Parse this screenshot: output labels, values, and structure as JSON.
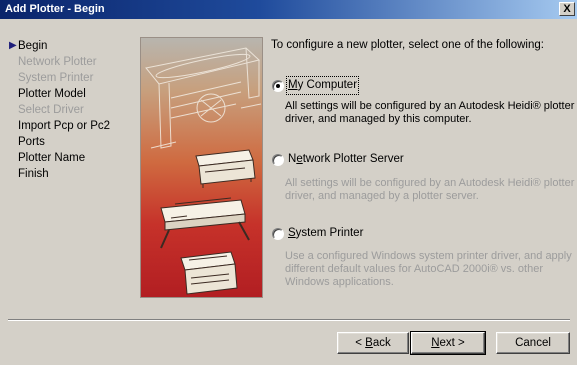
{
  "window": {
    "title": "Add Plotter - Begin",
    "close_glyph": "X"
  },
  "steps": [
    {
      "label": "Begin",
      "state": "current"
    },
    {
      "label": "Network Plotter",
      "state": "disabled"
    },
    {
      "label": "System Printer",
      "state": "disabled"
    },
    {
      "label": "Plotter Model",
      "state": "enabled"
    },
    {
      "label": "Select Driver",
      "state": "disabled"
    },
    {
      "label": "Import Pcp or Pc2",
      "state": "enabled"
    },
    {
      "label": "Ports",
      "state": "enabled"
    },
    {
      "label": "Plotter Name",
      "state": "enabled"
    },
    {
      "label": "Finish",
      "state": "enabled"
    }
  ],
  "main": {
    "intro": "To configure a new plotter, select one of the following:",
    "options": [
      {
        "label_prefix": "",
        "label_accel": "M",
        "label_rest": "y Computer",
        "selected": true,
        "description": "All settings will be configured by an Autodesk Heidi® plotter driver, and managed by this computer.",
        "description_enabled": true
      },
      {
        "label_prefix": "N",
        "label_accel": "e",
        "label_rest": "twork Plotter Server",
        "selected": false,
        "description": "All settings will be configured by an Autodesk Heidi® plotter driver, and managed by a plotter server.",
        "description_enabled": false
      },
      {
        "label_prefix": "",
        "label_accel": "S",
        "label_rest": "ystem Printer",
        "selected": false,
        "description": "Use a configured Windows system printer driver, and apply different default values for AutoCAD 2000i® vs. other Windows applications.",
        "description_enabled": false
      }
    ]
  },
  "buttons": {
    "back": {
      "prefix": "< ",
      "accel": "B",
      "rest": "ack"
    },
    "next": {
      "prefix": "",
      "accel": "N",
      "rest": "ext >"
    },
    "cancel": {
      "label": "Cancel"
    }
  },
  "icons": {
    "current_step": "triangle-right-icon",
    "art": "plotter-printers-illustration",
    "close": "close-icon"
  },
  "colors": {
    "titlebar_start": "#0a246a",
    "titlebar_end": "#a6caf0",
    "dialog_bg": "#d4d0c8",
    "disabled_text": "#9c9c9c"
  }
}
